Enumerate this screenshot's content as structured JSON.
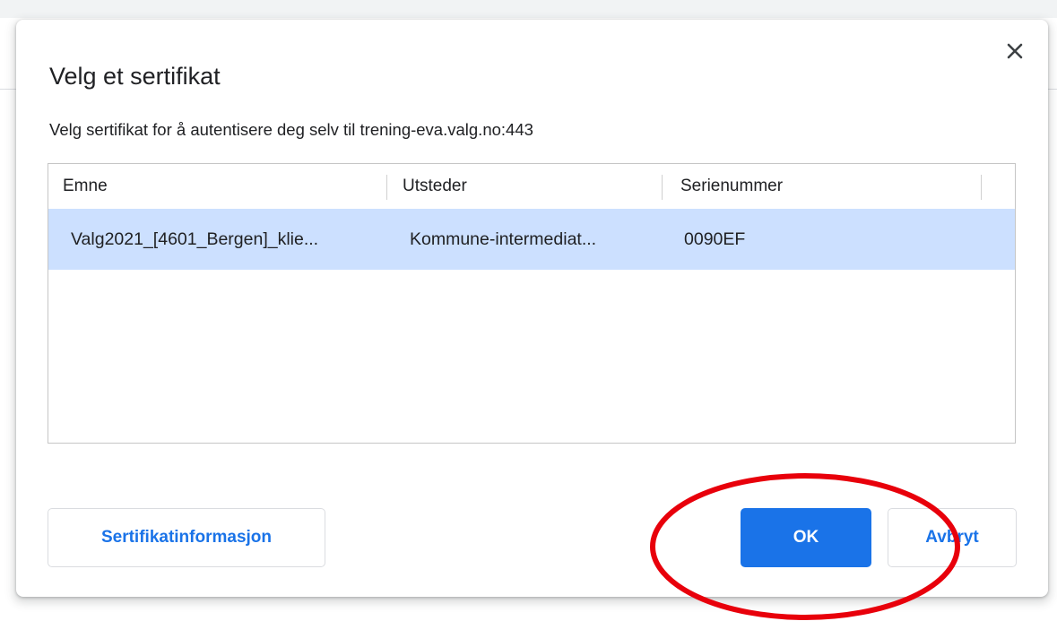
{
  "dialog": {
    "title": "Velg et sertifikat",
    "subtitle": "Velg sertifikat for å autentisere deg selv til trening-eva.valg.no:443",
    "close_icon": "close-icon"
  },
  "table": {
    "columns": [
      "Emne",
      "Utsteder",
      "Serienummer"
    ],
    "rows": [
      {
        "subject": "Valg2021_[4601_Bergen]_klie...",
        "issuer": "Kommune-intermediat...",
        "serial": "0090EF",
        "selected": true
      }
    ]
  },
  "buttons": {
    "info_label": "Sertifikatinformasjon",
    "ok_label": "OK",
    "cancel_label": "Avbryt"
  },
  "colors": {
    "accent": "#1a73e8",
    "selection": "#cce0ff",
    "annotation": "#e8000b"
  }
}
